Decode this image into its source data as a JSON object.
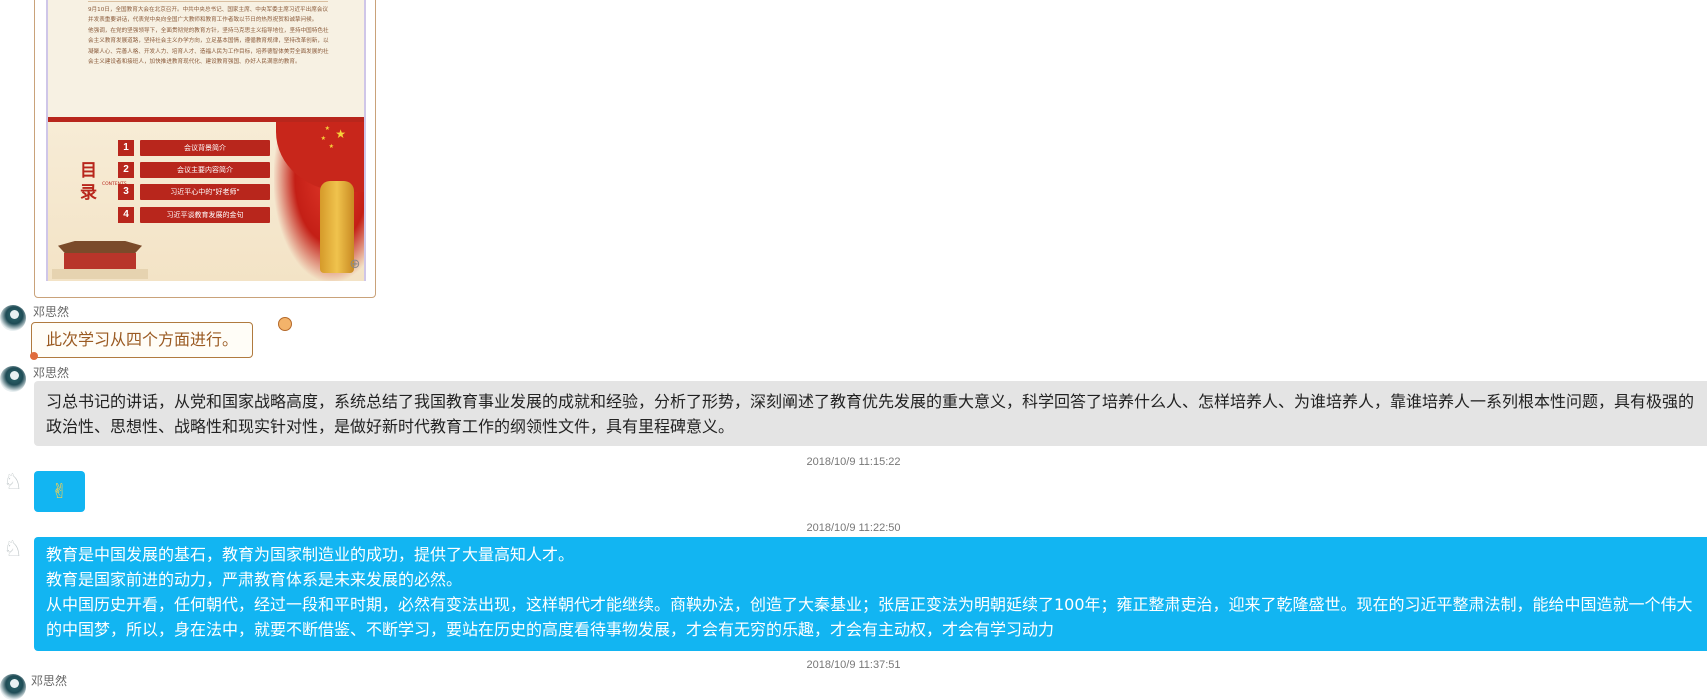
{
  "image_message": {
    "slide_paragraphs": [
      "9月10日，全国教育大会在北京召开。中共中央总书记、国家主席、中央军委主席习近平出席会议并发表重要讲话，代表党中央向全国广大教师和教育工作者致以节日的热烈祝贺和诚挚问候。",
      "他强调，在党的坚强领导下，全面贯彻党的教育方针，坚持马克思主义指导地位，坚持中国特色社会主义教育发展道路，坚持社会主义办学方向，立足基本国情，遵循教育规律，坚持改革创新，以凝聚人心、完善人格、开发人力、培育人才、造福人民为工作目标，培养德智体美劳全面发展的社会主义建设者和接班人，加快推进教育现代化、建设教育强国、办好人民满意的教育。"
    ],
    "toc_title_chars": [
      "目",
      "录"
    ],
    "toc_contents_word": "CONTENTS",
    "toc_items": [
      {
        "num": "1",
        "label": "会议背景简介"
      },
      {
        "num": "2",
        "label": "会议主要内容简介"
      },
      {
        "num": "3",
        "label": "习近平心中的\"好老师\""
      },
      {
        "num": "4",
        "label": "习近平谈教育发展的金句"
      }
    ],
    "zoom_icon": "zoom-in-icon"
  },
  "messages": [
    {
      "sender": "邓思然",
      "avatar": "teal-avatar",
      "text": "此次学习从四个方面进行。"
    },
    {
      "sender": "邓思然",
      "avatar": "teal-avatar",
      "text": "习总书记的讲话，从党和国家战略高度，系统总结了我国教育事业发展的成就和经验，分析了形势，深刻阐述了教育优先发展的重大意义，科学回答了培养什么人、怎样培养人、为谁培养人，靠谁培养人一系列根本性问题，具有极强的政治性、思想性、战略性和现实针对性，是做好新时代教育工作的纲领性文件，具有里程碑意义。"
    },
    {
      "timestamp": "2018/10/9 11:15:22",
      "avatar": "sketch-avatar",
      "emoji": "✌",
      "emoji_name": "victory-hand-emoji"
    },
    {
      "timestamp": "2018/10/9 11:22:50",
      "avatar": "sketch-avatar",
      "lines": [
        "教育是中国发展的基石，教育为国家制造业的成功，提供了大量高知人才。",
        "教育是国家前进的动力，严肃教育体系是未来发展的必然。",
        "从中国历史开看，任何朝代，经过一段和平时期，必然有变法出现，这样朝代才能继续。商鞅办法，创造了大秦基业；张居正变法为明朝延续了100年；雍正整肃吏治，迎来了乾隆盛世。现在的习近平整肃法制，能给中国造就一个伟大的中国梦，所以，身在法中，就要不断借鉴、不断学习，要站在历史的高度看待事物发展，才会有无穷的乐趣，才会有主动权，才会有学习动力"
      ]
    },
    {
      "timestamp": "2018/10/9 11:37:51",
      "sender": "邓思然"
    }
  ],
  "colors": {
    "outgoing_bubble": "#12b5f2",
    "incoming_bubble": "#e4e4e4",
    "outline_bubble_border": "#b07a3e",
    "outline_bubble_text": "#9a5a22",
    "slide_red": "#b8261c"
  }
}
